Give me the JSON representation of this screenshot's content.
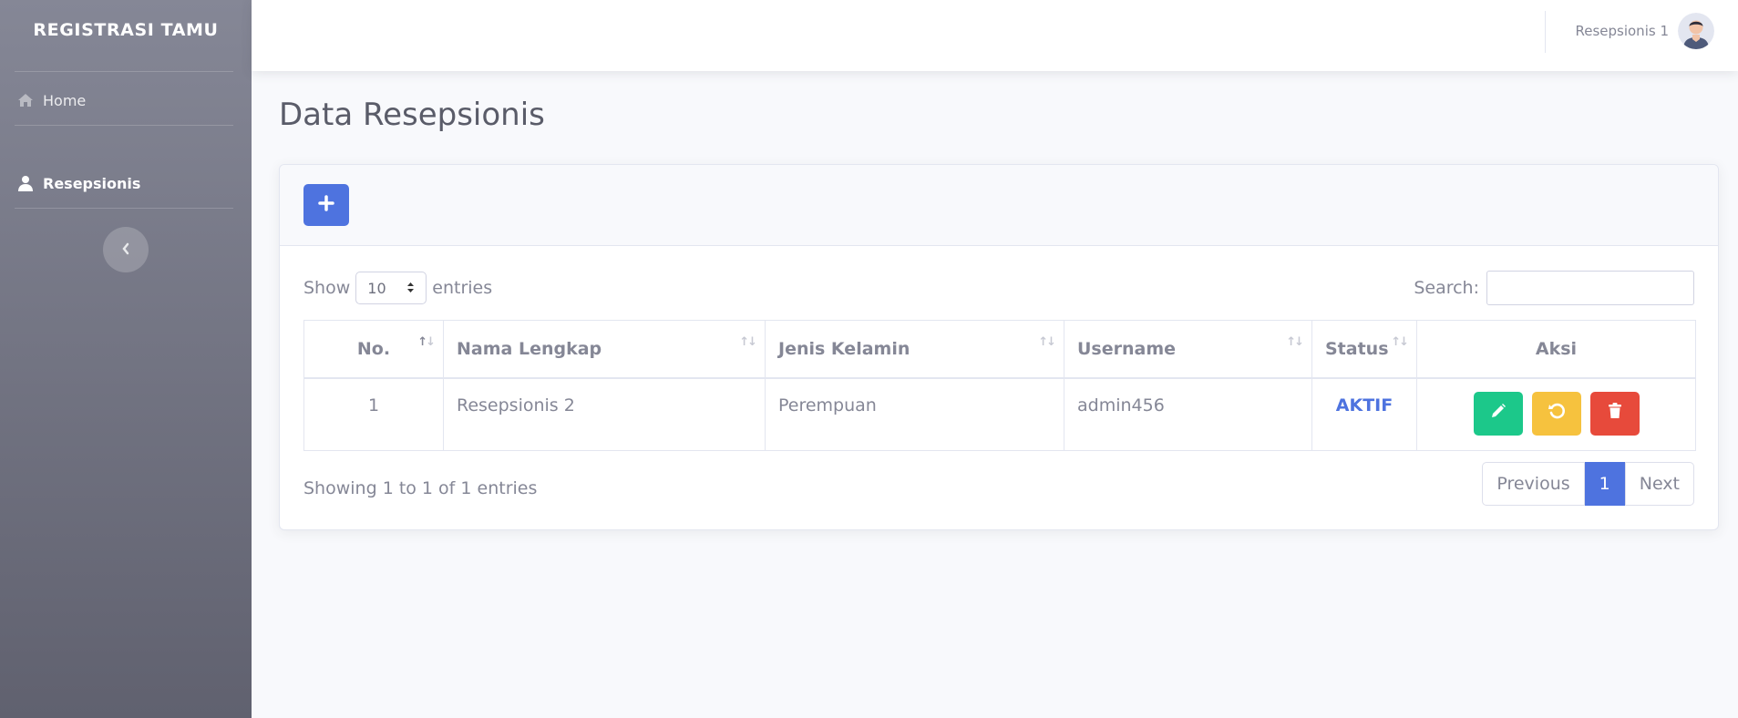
{
  "brand": "REGISTRASI TAMU",
  "sidebar": {
    "items": [
      {
        "label": "Home",
        "icon": "home-icon",
        "active": false
      },
      {
        "label": "Resepsionis",
        "icon": "user-icon",
        "active": true
      }
    ]
  },
  "topbar": {
    "user_name": "Resepsionis 1"
  },
  "page": {
    "title": "Data Resepsionis"
  },
  "table_controls": {
    "show_label": "Show",
    "entries_value": "10",
    "entries_label": "entries",
    "search_label": "Search:",
    "search_value": ""
  },
  "table": {
    "headers": [
      "No.",
      "Nama Lengkap",
      "Jenis Kelamin",
      "Username",
      "Status",
      "Aksi"
    ],
    "rows": [
      {
        "no": "1",
        "nama": "Resepsionis 2",
        "jenis_kelamin": "Perempuan",
        "username": "admin456",
        "status": "AKTIF"
      }
    ]
  },
  "footer": {
    "info": "Showing 1 to 1 of 1 entries",
    "prev": "Previous",
    "page": "1",
    "next": "Next"
  },
  "colors": {
    "primary": "#4e73df",
    "success": "#1cc88a",
    "warning": "#f6c23e",
    "danger": "#e74a3b"
  }
}
